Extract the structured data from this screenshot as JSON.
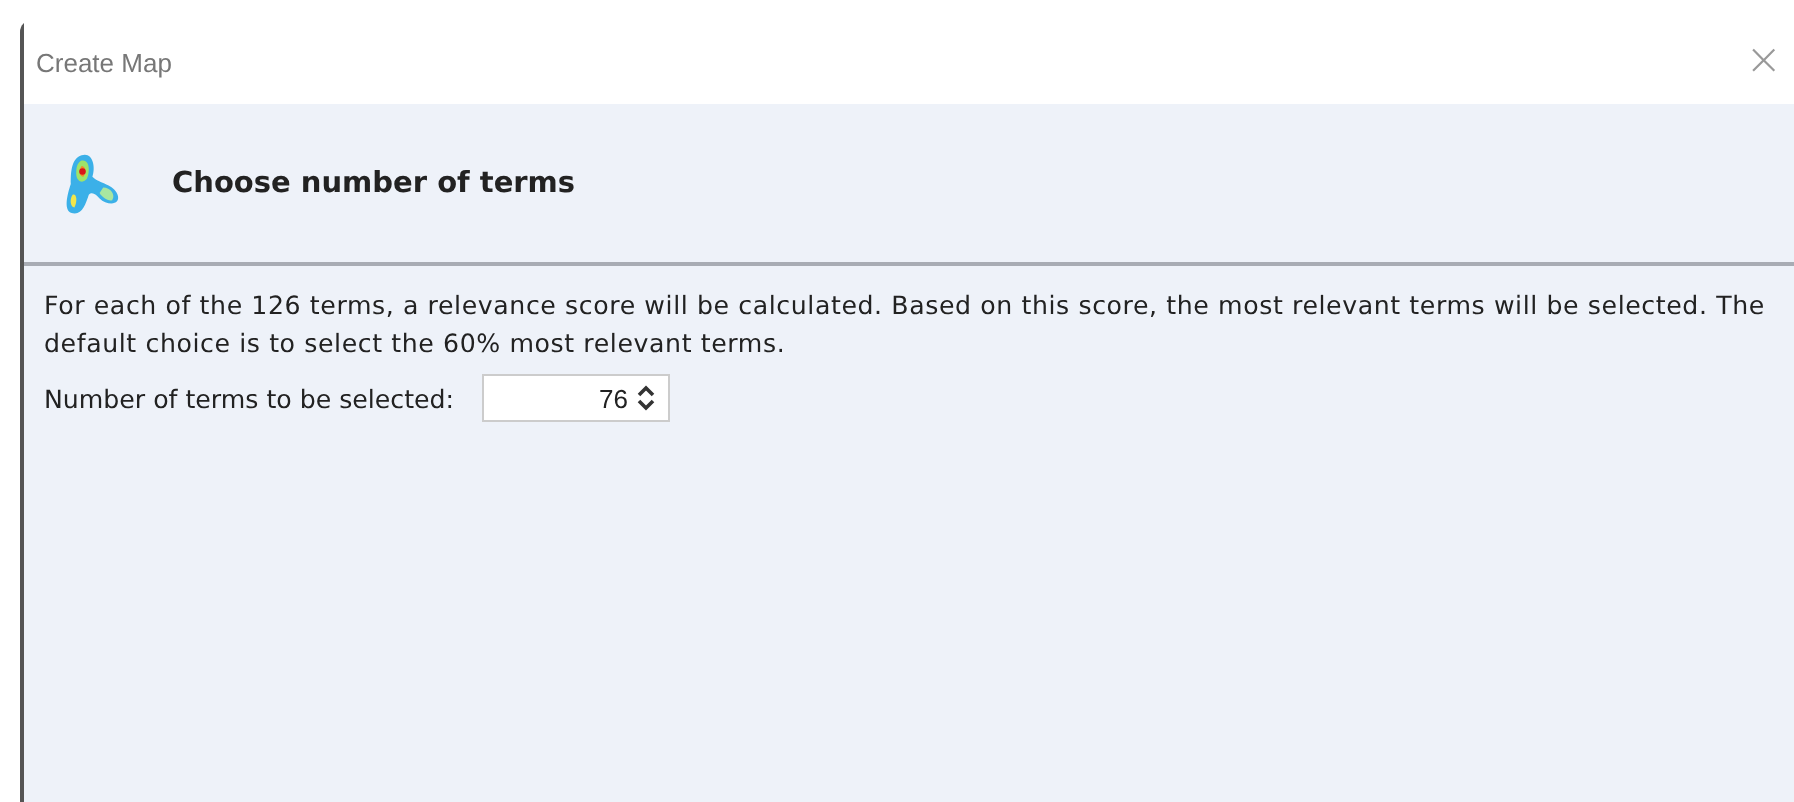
{
  "window": {
    "title": "Create Map",
    "close": "×"
  },
  "header": {
    "title": "Choose number of terms"
  },
  "description": "For each of the 126 terms, a relevance score will be calculated. Based on this score, the most relevant terms will be selected. The default choice is to select the 60% most relevant terms.",
  "field": {
    "label": "Number of terms to be selected:",
    "value": "76"
  }
}
